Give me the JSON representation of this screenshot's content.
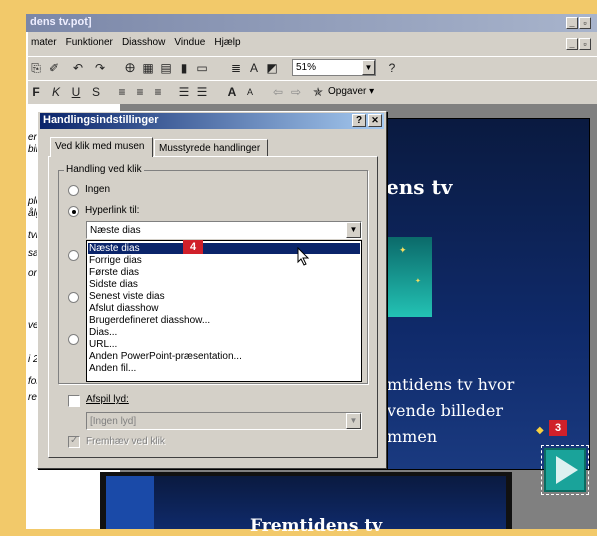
{
  "app": {
    "title": "dens tv.pot]",
    "menus": [
      "mater",
      "Funktioner",
      "Diasshow",
      "Vindue",
      "Hjælp"
    ],
    "zoom": "51%",
    "tasks_label": "Opgaver ▾"
  },
  "outline": {
    "lines": [
      "en",
      "bil",
      "plc",
      "ålg",
      "tvi",
      "sa",
      "or",
      "ve",
      "i 2",
      "for",
      "rer"
    ]
  },
  "slide": {
    "title_fragment": "ens tv",
    "body_lines": [
      "mtidens tv hvor",
      "vende billeder",
      "mmen"
    ],
    "second_title": "Fremtidens tv"
  },
  "dialog": {
    "title": "Handlingsindstillinger",
    "help": "?",
    "close": "✕",
    "tabs": [
      "Ved klik med musen",
      "Musstyrede handlinger"
    ],
    "group_label": "Handling ved klik",
    "opt_none": "Ingen",
    "opt_hyperlink": "Hyperlink til:",
    "hyperlink_value": "Næste dias",
    "hyperlink_options": [
      "Næste dias",
      "Forrige dias",
      "Første dias",
      "Sidste dias",
      "Senest viste dias",
      "Afslut diasshow",
      "Brugerdefineret diasshow...",
      "Dias...",
      "URL...",
      "Anden PowerPoint-præsentation...",
      "Anden fil..."
    ],
    "play_sound_label": "Afspil lyd:",
    "sound_value": "[Ingen lyd]",
    "highlight_label": "Fremhæv ved klik"
  },
  "badges": {
    "b4": "4",
    "b3": "3"
  },
  "colors": {
    "slide_bg": "#0f2a6a",
    "title_bar": "#0a246a",
    "badge": "#d0202a",
    "page_bg": "#f2c96a"
  }
}
